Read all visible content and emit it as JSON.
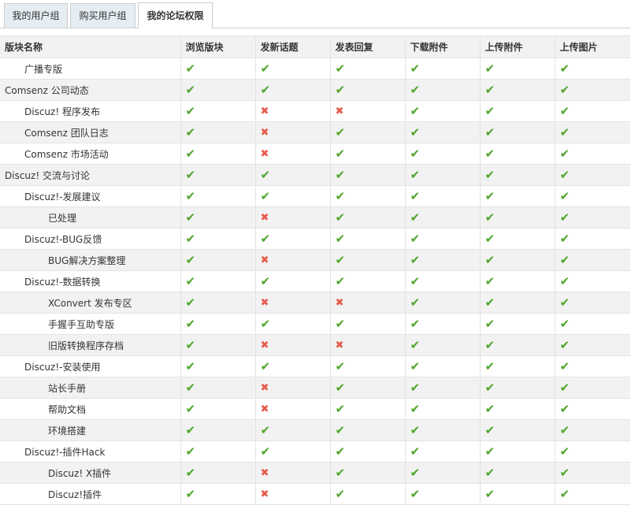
{
  "tabs": [
    {
      "label": "我的用户组",
      "active": false
    },
    {
      "label": "购买用户组",
      "active": false
    },
    {
      "label": "我的论坛权限",
      "active": true
    }
  ],
  "columns": [
    "版块名称",
    "浏览版块",
    "发新话题",
    "发表回复",
    "下载附件",
    "上传附件",
    "上传图片"
  ],
  "icons": {
    "yes": "check-icon",
    "no": "cross-icon",
    "yes_color": "#4fa52b",
    "no_color": "#e55b4b"
  },
  "rows": [
    {
      "name": "广播专版",
      "level": 1,
      "perms": [
        true,
        true,
        true,
        true,
        true,
        true
      ]
    },
    {
      "name": "Comsenz 公司动态",
      "level": 0,
      "perms": [
        true,
        true,
        true,
        true,
        true,
        true
      ]
    },
    {
      "name": "Discuz! 程序发布",
      "level": 1,
      "perms": [
        true,
        false,
        false,
        true,
        true,
        true
      ]
    },
    {
      "name": "Comsenz 团队日志",
      "level": 1,
      "perms": [
        true,
        false,
        true,
        true,
        true,
        true
      ]
    },
    {
      "name": "Comsenz 市场活动",
      "level": 1,
      "perms": [
        true,
        false,
        true,
        true,
        true,
        true
      ]
    },
    {
      "name": "Discuz! 交流与讨论",
      "level": 0,
      "perms": [
        true,
        true,
        true,
        true,
        true,
        true
      ]
    },
    {
      "name": "Discuz!-发展建议",
      "level": 1,
      "perms": [
        true,
        true,
        true,
        true,
        true,
        true
      ]
    },
    {
      "name": "已处理",
      "level": 2,
      "perms": [
        true,
        false,
        true,
        true,
        true,
        true
      ]
    },
    {
      "name": "Discuz!-BUG反馈",
      "level": 1,
      "perms": [
        true,
        true,
        true,
        true,
        true,
        true
      ]
    },
    {
      "name": "BUG解决方案整理",
      "level": 2,
      "perms": [
        true,
        false,
        true,
        true,
        true,
        true
      ]
    },
    {
      "name": "Discuz!-数据转换",
      "level": 1,
      "perms": [
        true,
        true,
        true,
        true,
        true,
        true
      ]
    },
    {
      "name": "XConvert 发布专区",
      "level": 2,
      "perms": [
        true,
        false,
        false,
        true,
        true,
        true
      ]
    },
    {
      "name": "手握手互助专版",
      "level": 2,
      "perms": [
        true,
        true,
        true,
        true,
        true,
        true
      ]
    },
    {
      "name": "旧版转换程序存档",
      "level": 2,
      "perms": [
        true,
        false,
        false,
        true,
        true,
        true
      ]
    },
    {
      "name": "Discuz!-安装使用",
      "level": 1,
      "perms": [
        true,
        true,
        true,
        true,
        true,
        true
      ]
    },
    {
      "name": "站长手册",
      "level": 2,
      "perms": [
        true,
        false,
        true,
        true,
        true,
        true
      ]
    },
    {
      "name": "帮助文档",
      "level": 2,
      "perms": [
        true,
        false,
        true,
        true,
        true,
        true
      ]
    },
    {
      "name": "环境搭建",
      "level": 2,
      "perms": [
        true,
        true,
        true,
        true,
        true,
        true
      ]
    },
    {
      "name": "Discuz!-插件Hack",
      "level": 1,
      "perms": [
        true,
        true,
        true,
        true,
        true,
        true
      ]
    },
    {
      "name": "Discuz! X插件",
      "level": 2,
      "perms": [
        true,
        false,
        true,
        true,
        true,
        true
      ]
    },
    {
      "name": "Discuz!插件",
      "level": 2,
      "perms": [
        true,
        false,
        true,
        true,
        true,
        true
      ]
    }
  ]
}
